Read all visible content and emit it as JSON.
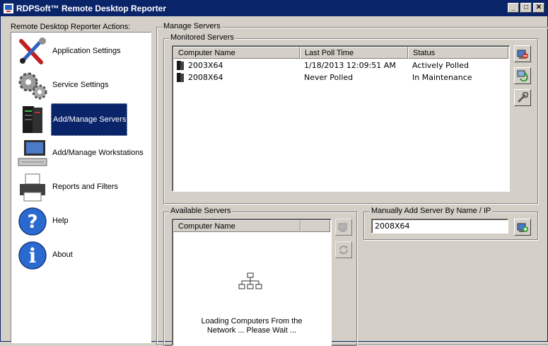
{
  "window": {
    "title": "RDPSoft™ Remote Desktop Reporter",
    "minimize_glyph": "_",
    "maximize_glyph": "□",
    "close_glyph": "✕"
  },
  "actions": {
    "label": "Remote Desktop Reporter Actions:",
    "items": [
      {
        "label": "Application Settings",
        "icon": "tools-icon"
      },
      {
        "label": "Service Settings",
        "icon": "gears-icon"
      },
      {
        "label": "Add/Manage Servers",
        "icon": "server-icon",
        "selected": true
      },
      {
        "label": "Add/Manage Workstations",
        "icon": "workstation-icon"
      },
      {
        "label": "Reports and Filters",
        "icon": "printer-icon"
      },
      {
        "label": "Help",
        "icon": "help-icon"
      },
      {
        "label": "About",
        "icon": "info-icon"
      }
    ]
  },
  "manage_servers": {
    "title": "Manage Servers",
    "monitored": {
      "title": "Monitored Servers",
      "columns": [
        "Computer Name",
        "Last Poll Time",
        "Status"
      ],
      "rows": [
        {
          "name": "2003X64",
          "last_poll": "1/18/2013 12:09:51 AM",
          "status": "Actively Polled"
        },
        {
          "name": "2008X64",
          "last_poll": "Never Polled",
          "status": "In Maintenance"
        }
      ]
    },
    "available": {
      "title": "Available Servers",
      "columns": [
        "Computer Name"
      ],
      "loading_line1": "Loading Computers From the",
      "loading_line2": "Network ... Please Wait ..."
    },
    "manual_add": {
      "title": "Manually Add Server By Name / IP",
      "value": "2008X64"
    }
  },
  "colors": {
    "titlebar": "#0a246a",
    "face": "#d4d0c8",
    "selection": "#0a246a"
  }
}
